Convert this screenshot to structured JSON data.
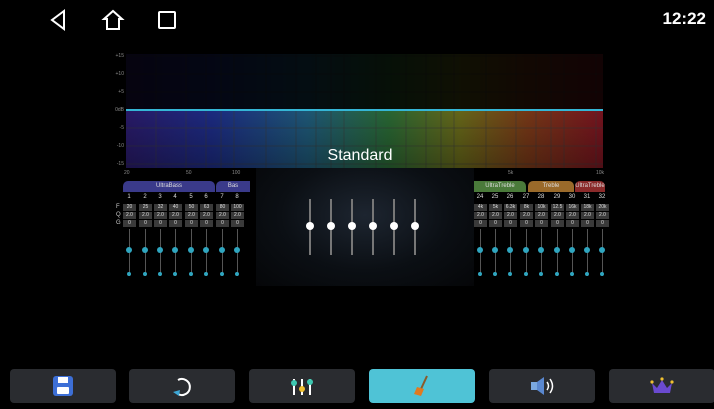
{
  "status": {
    "time": "12:22"
  },
  "nav": {
    "back": "back-icon",
    "home": "home-icon",
    "recent": "recent-apps-icon"
  },
  "graph": {
    "y_ticks": [
      "+15",
      "+10",
      "+5",
      "0dB",
      "-5",
      "-10",
      "-15"
    ],
    "x_ticks_left": [
      "20",
      "50",
      "100"
    ],
    "x_ticks_right": [
      "5k",
      "10k"
    ]
  },
  "preset": {
    "name": "Standard"
  },
  "left_bands": {
    "groups": [
      "UltraBass",
      "Bas"
    ],
    "numbers": [
      "1",
      "2",
      "3",
      "4",
      "5",
      "6",
      "7",
      "8"
    ],
    "freq": [
      "20",
      "25",
      "32",
      "40",
      "50",
      "63",
      "80",
      "100"
    ],
    "q": [
      "2.0",
      "2.0",
      "2.0",
      "2.0",
      "2.0",
      "2.0",
      "2.0",
      "2.0"
    ],
    "gain": [
      "0",
      "0",
      "0",
      "0",
      "0",
      "0",
      "0",
      "0"
    ],
    "row_labels": [
      "F",
      "Q",
      "G"
    ]
  },
  "right_bands": {
    "groups": [
      "UltraTreble",
      "Treble",
      "UltraTreble"
    ],
    "numbers": [
      "24",
      "25",
      "26",
      "27",
      "28",
      "29",
      "30",
      "31",
      "32"
    ],
    "freq": [
      "4k",
      "5k",
      "6.3k",
      "8k",
      "10k",
      "12.5",
      "16k",
      "18k",
      "20k"
    ],
    "q": [
      "2.0",
      "2.0",
      "2.0",
      "2.0",
      "2.0",
      "2.0",
      "2.0",
      "2.0",
      "2.0"
    ],
    "gain": [
      "0",
      "0",
      "0",
      "0",
      "0",
      "0",
      "0",
      "0",
      "0"
    ]
  },
  "bottom_buttons": [
    {
      "icon": "save-icon"
    },
    {
      "icon": "reset-icon"
    },
    {
      "icon": "equalizer-icon"
    },
    {
      "icon": "sweep-icon"
    },
    {
      "icon": "volume-icon"
    },
    {
      "icon": "crown-icon"
    }
  ],
  "colors": {
    "accent": "#4fc3d6",
    "curve": "#35b6d6",
    "button_bg": "#2a2c30"
  }
}
